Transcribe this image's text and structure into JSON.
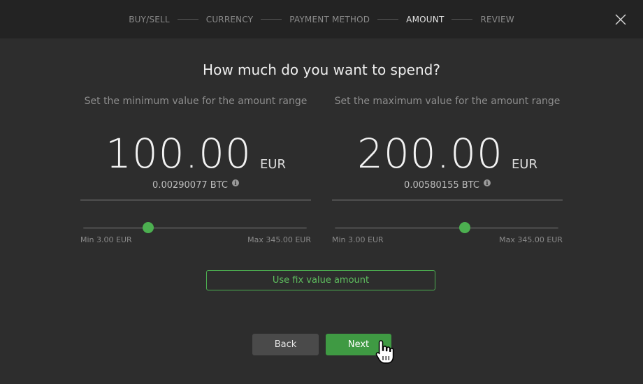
{
  "wizard": {
    "steps": [
      {
        "label": "BUY/SELL",
        "active": false
      },
      {
        "label": "CURRENCY",
        "active": false
      },
      {
        "label": "PAYMENT METHOD",
        "active": false
      },
      {
        "label": "AMOUNT",
        "active": true
      },
      {
        "label": "REVIEW",
        "active": false
      }
    ],
    "close_icon": "close-icon"
  },
  "main": {
    "title": "How much do you want to spend?",
    "minimum": {
      "subtitle": "Set the minimum value for the amount range",
      "amount": "100.00",
      "currency": "EUR",
      "btc_equivalent": "0.00290077 BTC",
      "slider_min_label": "Min 3.00 EUR",
      "slider_max_label": "Max 345.00 EUR",
      "slider_fraction": 0.29
    },
    "maximum": {
      "subtitle": "Set the maximum value for the amount range",
      "amount": "200.00",
      "currency": "EUR",
      "btc_equivalent": "0.00580155 BTC",
      "slider_min_label": "Min 3.00 EUR",
      "slider_max_label": "Max 345.00 EUR",
      "slider_fraction": 0.58
    },
    "fix_value_button": "Use fix value amount"
  },
  "footer": {
    "back_label": "Back",
    "next_label": "Next"
  },
  "colors": {
    "accent": "#4caf50",
    "background": "#2d2d2d",
    "topbar": "#232323"
  }
}
